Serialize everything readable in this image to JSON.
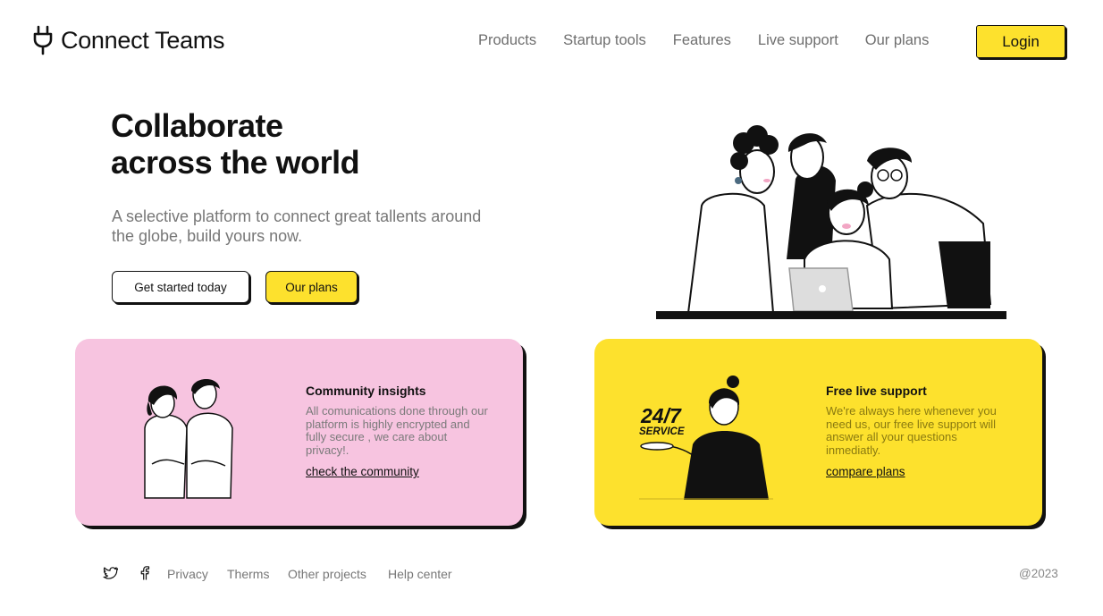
{
  "brand": {
    "name": "Connect Teams",
    "logo_icon": "plug-icon"
  },
  "nav": {
    "items": [
      {
        "label": "Products"
      },
      {
        "label": "Startup tools"
      },
      {
        "label": "Features"
      },
      {
        "label": "Live support"
      },
      {
        "label": "Our plans"
      }
    ],
    "login_label": "Login"
  },
  "hero": {
    "title_line1": "Collaborate",
    "title_line2": "across the world",
    "subtitle": "A selective platform to connect great tallents around the globe, build yours now.",
    "primary_button": "Get started today",
    "secondary_button": "Our plans"
  },
  "cards": [
    {
      "title": "Community insights",
      "description": "All comunications done through our platform is highly encrypted and fully secure , we care about privacy!.",
      "link": "check the community"
    },
    {
      "title": "Free live support",
      "description": "We're always here whenever you need us, our free live support will answer all your questions inmediatly.",
      "link": "compare plans",
      "badge_line1": "24/7",
      "badge_line2": "SERVICE"
    }
  ],
  "footer": {
    "social": [
      "twitter-icon",
      "facebook-icon"
    ],
    "links": [
      {
        "label": "Privacy"
      },
      {
        "label": "Therms"
      },
      {
        "label": "Other projects"
      },
      {
        "label": "Help center"
      }
    ],
    "copyright": "@2023"
  },
  "colors": {
    "accent_yellow": "#fde12d",
    "card_pink": "#f7c4e0",
    "text_dark": "#111111",
    "text_muted": "#777777"
  }
}
